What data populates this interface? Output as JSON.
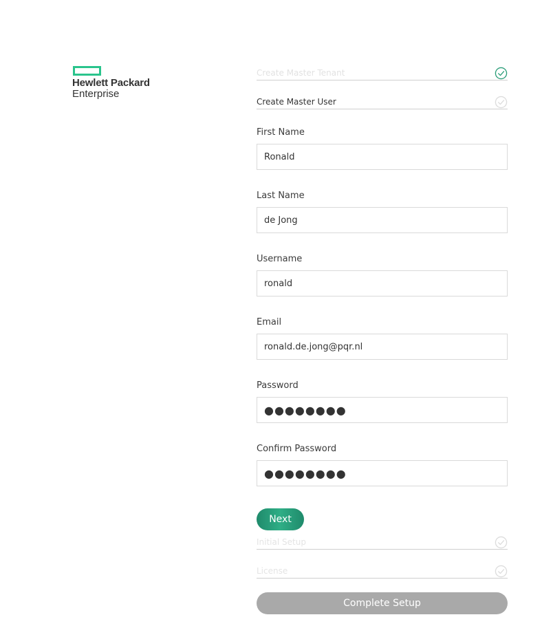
{
  "brand": {
    "logo_line1": "Hewlett Packard",
    "logo_line2": "Enterprise",
    "accent_color": "#2ac48c"
  },
  "steps_top": [
    {
      "label": "Create Master Tenant",
      "state": "completed"
    },
    {
      "label": "Create Master User",
      "state": "active"
    }
  ],
  "form": {
    "first_name": {
      "label": "First Name",
      "value": "Ronald"
    },
    "last_name": {
      "label": "Last Name",
      "value": "de Jong"
    },
    "username": {
      "label": "Username",
      "value": "ronald"
    },
    "email": {
      "label": "Email",
      "value": "ronald.de.jong@pqr.nl"
    },
    "password": {
      "label": "Password",
      "value": "●●●●●●●●"
    },
    "confirm_password": {
      "label": "Confirm Password",
      "value": "●●●●●●●●"
    }
  },
  "next_button": {
    "label": "Next",
    "color": "#2a9d78"
  },
  "steps_bottom": [
    {
      "label": "Initial Setup",
      "state": "future"
    },
    {
      "label": "License",
      "state": "future"
    }
  ],
  "complete_button": {
    "label": "Complete Setup",
    "color": "#a9a9a9"
  },
  "icons": {
    "completed_check": "check-circle-icon",
    "pending_check": "check-circle-outline-icon"
  }
}
